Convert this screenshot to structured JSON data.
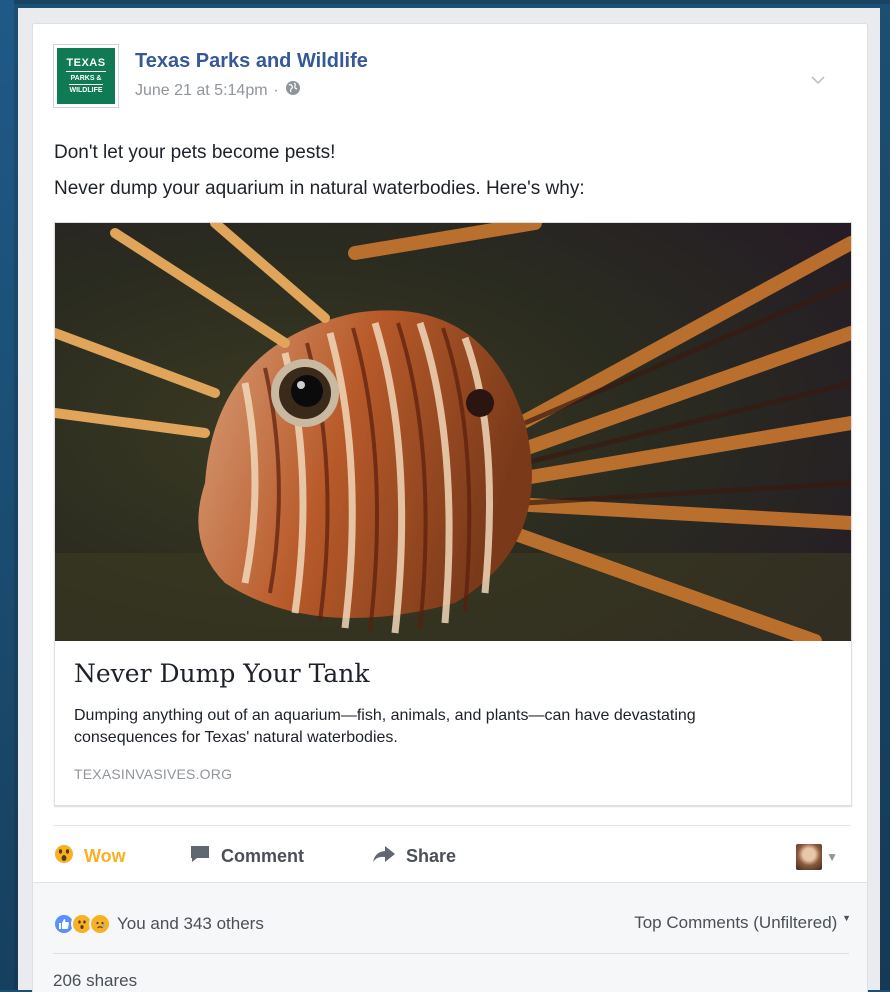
{
  "post": {
    "page_name": "Texas Parks and Wildlife",
    "timestamp": "June 21 at 5:14pm",
    "separator": "·",
    "privacy_icon": "globe-icon",
    "logo": {
      "line1": "TEXAS",
      "line2": "PARKS &",
      "line3": "WILDLIFE"
    },
    "text_line1": "Don't let your pets become pests!",
    "text_line2": "Never dump your aquarium in natural waterbodies. Here's why:"
  },
  "link": {
    "title": "Never Dump Your Tank",
    "description": "Dumping anything out of an aquarium—fish, animals, and plants—can have devastating consequences for Texas' natural waterbodies.",
    "domain": "TEXASINVASIVES.ORG",
    "image_subject": "lionfish"
  },
  "actions": {
    "wow_label": "Wow",
    "comment_label": "Comment",
    "share_label": "Share"
  },
  "footer": {
    "reaction_count": "You and 343 others",
    "top_comments": "Top Comments (Unfiltered)",
    "shares": "206 shares"
  },
  "colors": {
    "link_blue": "#365899",
    "wow_yellow": "#f7b125",
    "like_blue": "#5890ff",
    "logo_green": "#0f7a54"
  }
}
